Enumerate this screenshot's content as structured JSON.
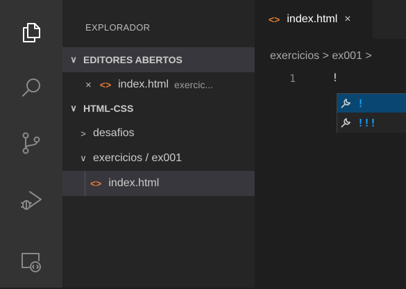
{
  "sidebar": {
    "title": "EXPLORADOR",
    "open_editors": {
      "label": "EDITORES ABERTOS",
      "items": [
        {
          "close": "×",
          "icon": "html-file-icon",
          "name": "index.html",
          "path": "exercic..."
        }
      ]
    },
    "folder": {
      "label": "HTML-CSS",
      "items": [
        {
          "chevron": ">",
          "name": "desafios"
        },
        {
          "chevron": "∨",
          "name": "exercicios / ex001"
        },
        {
          "icon": "html-file-icon",
          "name": "index.html"
        }
      ]
    }
  },
  "editor": {
    "tab": {
      "label": "index.html",
      "close": "×"
    },
    "breadcrumb": "exercicios > ex001 >",
    "line_number": "1",
    "code": "!",
    "suggestions": [
      {
        "icon": "wrench-icon",
        "text": "!"
      },
      {
        "icon": "wrench-icon",
        "text": "!!!"
      }
    ]
  },
  "activity_bar": {
    "icons": [
      "files-icon",
      "search-icon",
      "source-control-icon",
      "run-debug-icon",
      "remote-explorer-icon"
    ]
  },
  "colors": {
    "html_icon": "#e37933",
    "suggestion_highlight": "#18a3ff",
    "selection": "#094771"
  }
}
